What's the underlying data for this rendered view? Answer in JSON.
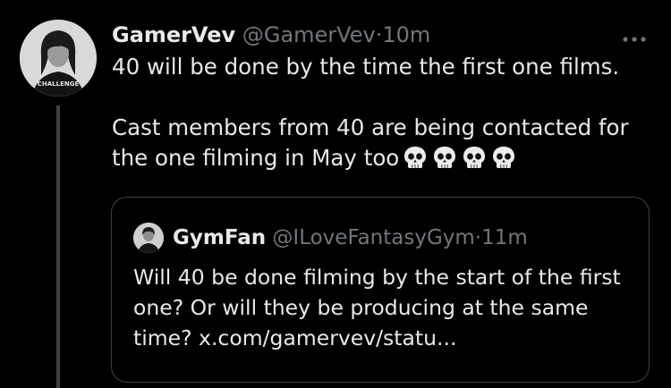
{
  "colors": {
    "background": "#000000",
    "text_primary": "#e7e9ea",
    "text_secondary": "#71767b",
    "border": "#3e4144"
  },
  "tweet": {
    "display_name": "GamerVev",
    "handle": "@GamerVev",
    "separator": "·",
    "time": "10m",
    "avatar_shirt_text": "CHALLENGE",
    "more_icon": "more-horizontal-icon",
    "paragraphs": [
      "40 will be done by the time the first one films.",
      "Cast members from 40 are being contacted for the one filming in May too"
    ],
    "emoji": [
      "skull-icon",
      "skull-icon",
      "skull-icon",
      "skull-icon"
    ]
  },
  "quote": {
    "display_name": "GymFan",
    "handle": "@ILoveFantasyGym",
    "separator": "·",
    "time": "11m",
    "text": "Will 40 be done filming by the start of the first one? Or will they be producing at the same time? x.com/gamervev/statu..."
  }
}
